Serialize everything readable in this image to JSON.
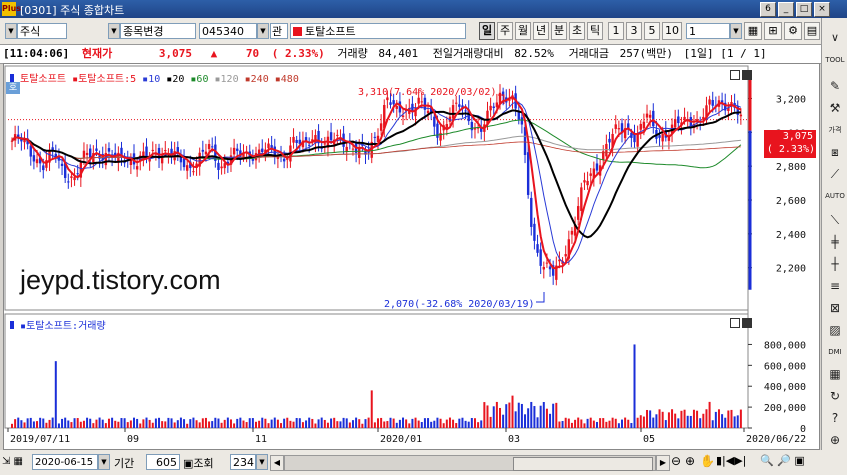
{
  "window": {
    "title": "[0301] 주식 종합차트",
    "logo": "Plus",
    "win_num": "6"
  },
  "toolbar": {
    "market": "주식",
    "mode": "종목변경",
    "code": "045340",
    "relation": "관",
    "name": "토탈소프트",
    "periods": [
      "일",
      "주",
      "월",
      "년",
      "분",
      "초",
      "틱"
    ],
    "numbers": [
      "1",
      "3",
      "5",
      "10"
    ],
    "count_value": "1"
  },
  "info": {
    "time": "[11:04:06]",
    "label_price": "현재가",
    "price": "3,075",
    "arrow": "▲",
    "change": "70",
    "change_pct": "( 2.33%)",
    "vol_label": "거래량",
    "volume": "84,401",
    "prev_vol_label": "전일거래량대비",
    "prev_vol_ratio": "82.52%",
    "amount_label": "거래대금",
    "amount": "257(백만)",
    "period": "[1일]",
    "page": "[1 / 1]"
  },
  "legend": {
    "name1": "토탈소프트",
    "name2": "토탈소프트:5",
    "ma": [
      "10",
      "20",
      "60",
      "120",
      "240",
      "480"
    ],
    "ma_colors": [
      "#2a3bd6",
      "#000000",
      "#1d8a2a",
      "#999999",
      "#c0392b",
      "#c0392b"
    ]
  },
  "chart": {
    "max_annotation": "3,310(7.64% 2020/03/02)",
    "min_annotation": "2,070(-32.68% 2020/03/19)",
    "price_box": "3,075",
    "pct_box": "( 2.33%)",
    "y_ticks": [
      "3,200",
      "3,000",
      "2,800",
      "2,600",
      "2,400",
      "2,200"
    ],
    "y_tick_values": [
      3200,
      3000,
      2800,
      2600,
      2400,
      2200
    ],
    "x_labels": [
      "2019/07/11",
      "09",
      "11",
      "2020/01",
      "03",
      "05",
      "2020/06/22"
    ],
    "vol_title": "토탈소프트:거래량",
    "vol_ticks": [
      "800,000",
      "600,000",
      "400,000",
      "200,000",
      "0"
    ],
    "vol_tick_values": [
      800000,
      600000,
      400000,
      200000,
      0
    ],
    "watermark": "jeypd.tistory.com",
    "colors": {
      "up": "#e8141e",
      "down": "#1a2ed8",
      "ma5": "#e8141e",
      "ma10": "#2a3bd6",
      "ma20": "#000000",
      "ma60": "#1d8a2a"
    }
  },
  "bottom": {
    "date": "2020-06-15",
    "period_label": "기간",
    "period_value": "605",
    "view_label": "조회",
    "view_value": "234"
  },
  "chart_data": {
    "type": "candlestick",
    "x": [
      "2019/07/11",
      "2019/09",
      "2019/11",
      "2020/01",
      "2020/03",
      "2020/05",
      "2020/06/22"
    ],
    "close_path": [
      2950,
      2940,
      2880,
      2800,
      2870,
      2780,
      2720,
      2850,
      2900,
      2860,
      2830,
      2870,
      2820,
      2850,
      2900,
      2880,
      2830,
      2800,
      2850,
      2900,
      2800,
      2870,
      2850,
      2880,
      2900,
      2870,
      2850,
      2950,
      2900,
      3000,
      2920,
      2950,
      2960,
      2900,
      2850,
      3000,
      3200,
      3100,
      3150,
      3180,
      3100,
      3000,
      3100,
      3150,
      3080,
      3000,
      3120,
      3250,
      3200,
      3000,
      2400,
      2200,
      2150,
      2300,
      2450,
      2700,
      2800,
      2900,
      3000,
      3050,
      2950,
      3100,
      3000,
      2980,
      3050,
      3100,
      3050,
      3150,
      3200,
      3150,
      3075
    ],
    "price_range": [
      2070,
      3310
    ],
    "volume_range": [
      0,
      900000
    ]
  }
}
